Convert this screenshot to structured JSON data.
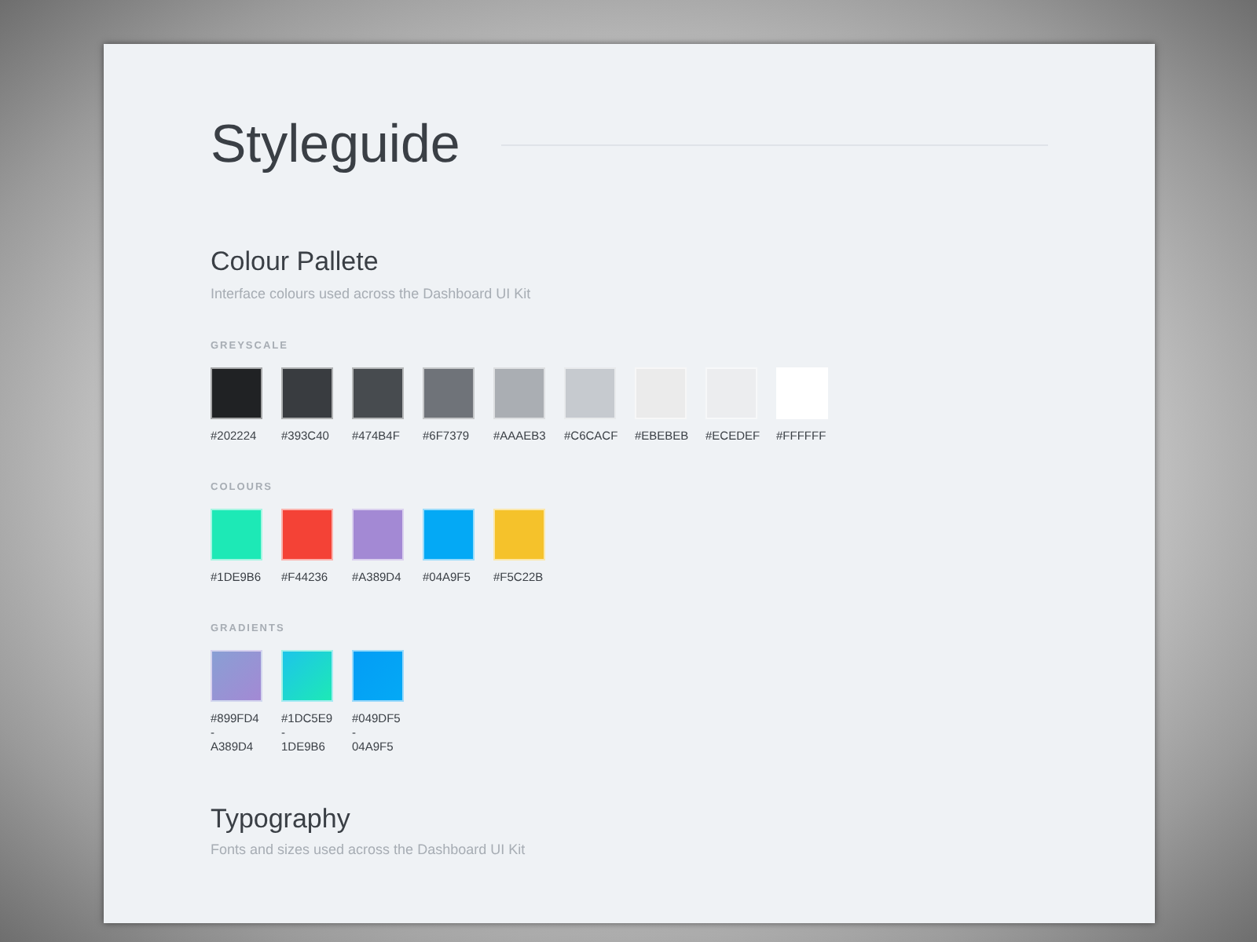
{
  "title": "Styleguide",
  "sections": [
    {
      "heading": "Colour Pallete",
      "subtitle": "Interface colours used across the Dashboard UI Kit",
      "groups": [
        {
          "label": "GREYSCALE",
          "kind": "solid",
          "swatches": [
            {
              "color": "#202224",
              "label": "#202224"
            },
            {
              "color": "#393c40",
              "label": "#393C40"
            },
            {
              "color": "#474b4f",
              "label": "#474B4F"
            },
            {
              "color": "#6f7379",
              "label": "#6F7379"
            },
            {
              "color": "#aaaeb3",
              "label": "#AAAEB3"
            },
            {
              "color": "#c6cacf",
              "label": "#C6CACF"
            },
            {
              "color": "#ebebeb",
              "label": "#EBEBEB"
            },
            {
              "color": "#ecedef",
              "label": "#ECEDEF"
            },
            {
              "color": "#ffffff",
              "label": "#FFFFFF"
            }
          ]
        },
        {
          "label": "COLOURS",
          "kind": "solid",
          "swatches": [
            {
              "color": "#1de9b6",
              "label": "#1DE9B6"
            },
            {
              "color": "#f44236",
              "label": "#F44236"
            },
            {
              "color": "#a389d4",
              "label": "#A389D4"
            },
            {
              "color": "#04a9f5",
              "label": "#04A9F5"
            },
            {
              "color": "#f5c22b",
              "label": "#F5C22B"
            }
          ]
        },
        {
          "label": "GRADIENTS",
          "kind": "gradient",
          "swatches": [
            {
              "label_top": "#899FD4",
              "separator": "-",
              "label_bottom": "A389D4"
            },
            {
              "label_top": "#1DC5E9",
              "separator": "-",
              "label_bottom": "1DE9B6"
            },
            {
              "label_top": "#049DF5",
              "separator": "-",
              "label_bottom": "04A9F5"
            }
          ]
        }
      ]
    },
    {
      "heading": "Typography",
      "subtitle": "Fonts and sizes used across the Dashboard UI Kit"
    }
  ]
}
